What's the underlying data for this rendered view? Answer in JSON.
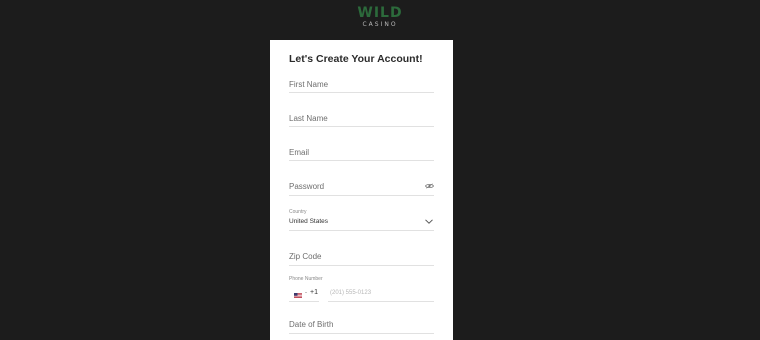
{
  "logo": {
    "main": "WILD",
    "sub": "CASINO"
  },
  "form": {
    "title": "Let's Create Your Account!",
    "first_name": {
      "placeholder": "First Name"
    },
    "last_name": {
      "placeholder": "Last Name"
    },
    "email": {
      "placeholder": "Email"
    },
    "password": {
      "placeholder": "Password",
      "icon": "eye-icon"
    },
    "country": {
      "label": "Country",
      "value": "United States",
      "icon": "chevron-down-icon"
    },
    "zip": {
      "placeholder": "Zip Code"
    },
    "phone": {
      "label": "Phone Number",
      "flag_icon": "us-flag-icon",
      "separator": "-",
      "dial_code": "+1",
      "placeholder": "(201) 555-0123"
    },
    "dob": {
      "placeholder": "Date of Birth"
    }
  },
  "colors": {
    "background": "#1c1c1c",
    "card": "#ffffff",
    "brand_green": "#2c6a3b",
    "divider": "#e1e1e1"
  }
}
